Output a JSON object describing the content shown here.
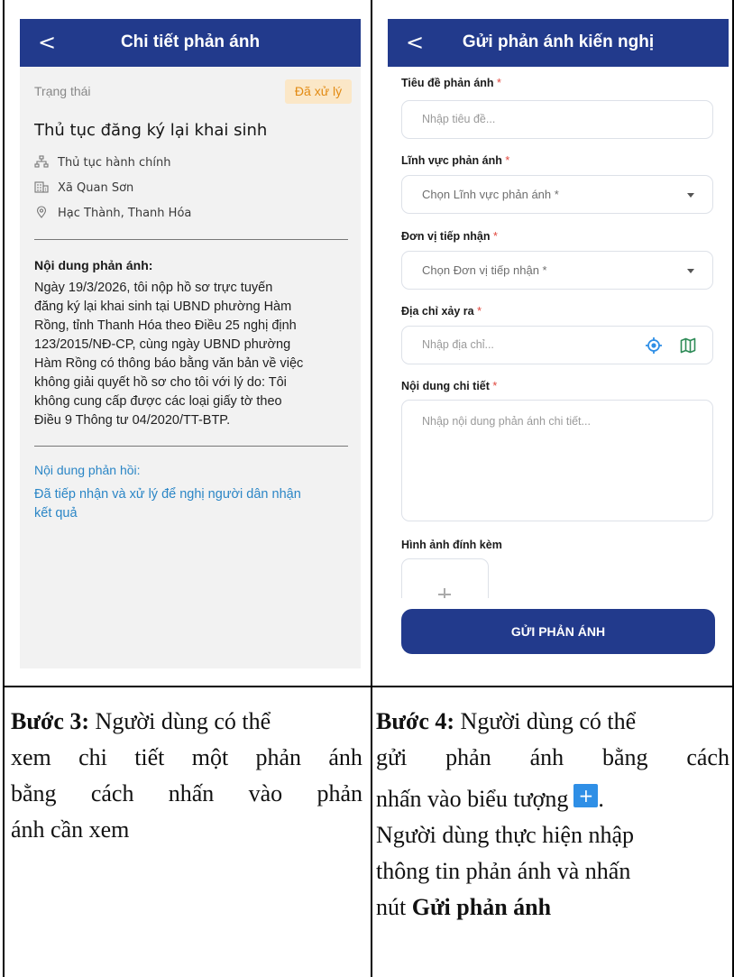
{
  "left_screen": {
    "appbar": {
      "back_glyph": "<",
      "title": "Chi tiết phản ánh"
    },
    "status": {
      "label": "Trạng thái",
      "badge": "Đã xử lý",
      "badge_color": "#e28a12"
    },
    "case_title": "Thủ tục đăng ký lại khai sinh",
    "meta": [
      {
        "icon": "hierarchy-icon",
        "text": "Thủ tục hành chính"
      },
      {
        "icon": "building-icon",
        "text": "Xã Quan Sơn"
      },
      {
        "icon": "location-pin-icon",
        "text": "Hạc Thành, Thanh Hóa"
      }
    ],
    "content_label": "Nội dung phản ánh:",
    "content_lines": [
      "Ngày 19/3/2026, tôi nộp hồ sơ trực tuyến",
      "đăng ký lại khai sinh tại UBND phường Hàm",
      "Rồng, tỉnh Thanh Hóa theo Điều 25 nghị định",
      "123/2015/NĐ-CP, cùng ngày UBND phường",
      "Hàm Rồng có thông báo bằng văn bản về việc",
      "không giải quyết hồ sơ cho tôi với lý do: Tôi",
      "không cung cấp được các loại giấy tờ theo",
      "Điều 9 Thông tư 04/2020/TT-BTP."
    ],
    "response_label": "Nội dung phản hồi:",
    "response_lines": [
      "Đã tiếp nhận và xử lý để nghị người dân nhận",
      "kết quả"
    ]
  },
  "right_screen": {
    "appbar": {
      "back_glyph": "<",
      "title": "Gửi phản ánh kiến nghị"
    },
    "title_field": {
      "label": "Tiêu đề phản ánh",
      "required": "*",
      "placeholder": "Nhập tiêu đề..."
    },
    "field_select": {
      "label": "Lĩnh vực phản ánh",
      "required": "*",
      "placeholder": "Chọn Lĩnh vực phản ánh *"
    },
    "unit_select": {
      "label": "Đơn vị tiếp nhận",
      "required": "*",
      "placeholder": "Chọn Đơn vị tiếp nhận *"
    },
    "address_field": {
      "label": "Địa chỉ xảy ra",
      "required": "*",
      "placeholder": "Nhập địa chỉ..."
    },
    "detail_field": {
      "label": "Nội dung chi tiết",
      "required": "*",
      "placeholder": "Nhập nội dung phản ánh chi tiết..."
    },
    "attachments": {
      "label": "Hình ảnh đính kèm"
    },
    "submit_label": "GỬI PHẢN ÁNH",
    "accent_color": "#223a8c"
  },
  "captions": {
    "step3": {
      "bold": "Bước 3:",
      "line1_rest": "Người dùng có thể",
      "line2_words": [
        "xem",
        "chi",
        "tiết",
        "một",
        "phản",
        "ánh"
      ],
      "line3_words": [
        "bằng",
        "cách",
        "nhấn",
        "vào",
        "phản"
      ],
      "line4": "ánh cần xem"
    },
    "step4": {
      "bold": "Bước 4:",
      "line1_rest": "Người dùng có thể",
      "line2_words": [
        "gửi",
        "phản",
        "ánh",
        "bằng",
        "cách"
      ],
      "line3_text": "nhấn vào biểu tượng",
      "plus_glyph": "+",
      "line3_tail": ".",
      "line4": "Người dùng thực hiện nhập",
      "line5": "thông tin phản ánh và nhấn",
      "line6_prefix": "nút",
      "line6_bold": "Gửi phản ánh"
    }
  }
}
